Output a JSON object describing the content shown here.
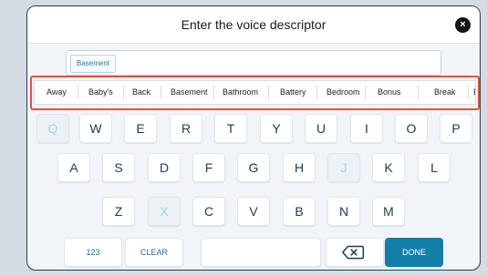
{
  "dialog": {
    "title": "Enter the voice descriptor",
    "close_label": "×"
  },
  "input": {
    "chip": "Basement"
  },
  "suggestions": [
    "Away",
    "Baby's",
    "Back",
    "Basement",
    "Bathroom",
    "Battery",
    "Bedroom",
    "Bonus",
    "Break",
    "B"
  ],
  "keyboard": {
    "row1": [
      "Q",
      "W",
      "E",
      "R",
      "T",
      "Y",
      "U",
      "I",
      "O",
      "P"
    ],
    "row2": [
      "A",
      "S",
      "D",
      "F",
      "G",
      "H",
      "J",
      "K",
      "L"
    ],
    "row3": [
      "Z",
      "X",
      "C",
      "V",
      "B",
      "N",
      "M"
    ],
    "numbers_label": "123",
    "clear_label": "CLEAR",
    "done_label": "DONE",
    "backspace_icon": "backspace-icon"
  },
  "colors": {
    "accent": "#137fa8",
    "highlight_outline": "#e0533d",
    "disabled_key_text": "#a9cfe0"
  }
}
